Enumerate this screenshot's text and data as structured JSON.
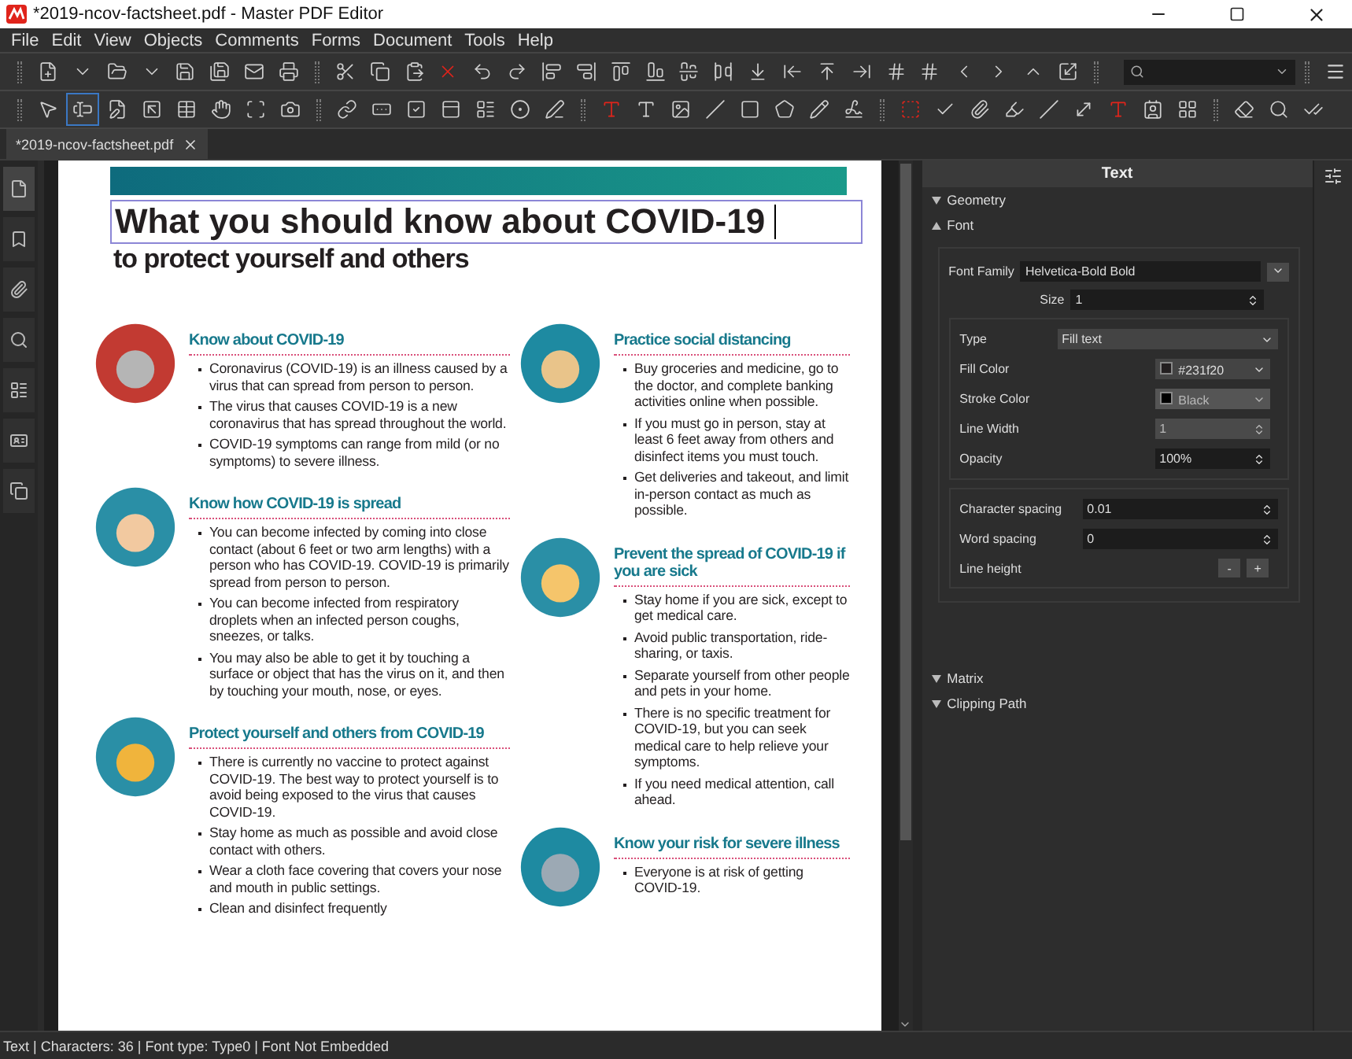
{
  "window": {
    "title": "*2019-ncov-factsheet.pdf - Master PDF Editor"
  },
  "menu": [
    "File",
    "Edit",
    "View",
    "Objects",
    "Comments",
    "Forms",
    "Document",
    "Tools",
    "Help"
  ],
  "edit_tools": [
    {
      "selected": false
    },
    {
      "selected": true
    },
    {
      "selected": false
    },
    {
      "selected": false
    },
    {
      "selected": false
    },
    {
      "selected": false
    },
    {
      "selected": false
    },
    {
      "selected": false
    }
  ],
  "tabs": [
    {
      "label": "*2019-ncov-factsheet.pdf",
      "selected": true
    }
  ],
  "side_tabs": [
    {
      "selected": true
    },
    {
      "selected": false
    },
    {
      "selected": false
    },
    {
      "selected": false
    },
    {
      "selected": false
    },
    {
      "selected": false
    },
    {
      "selected": false
    }
  ],
  "document": {
    "title": "What you should know about COVID-19",
    "subtitle": "to protect yourself and others",
    "columns": [
      [
        {
          "heading": "Know about COVID-19",
          "bullets": [
            "Coronavirus (COVID-19) is an illness caused by a virus that can spread from person to person.",
            "The virus that causes COVID-19 is a new coronavirus that has spread throughout the world.",
            "COVID-19 symptoms can range from mild (or no symptoms) to severe illness."
          ]
        },
        {
          "heading": "Know how COVID-19 is spread",
          "bullets": [
            "You can become infected by coming into close contact (about 6 feet or two arm lengths) with a person who has COVID-19. COVID-19 is primarily spread from person to person.",
            "You can become infected from respiratory droplets when an infected person coughs, sneezes, or talks.",
            "You may also be able to get it by touching a surface or object that has the virus on it, and then by touching your mouth, nose, or eyes."
          ]
        },
        {
          "heading": "Protect yourself and others from COVID-19",
          "bullets": [
            "There is currently no vaccine to protect against COVID-19. The best way to protect yourself is to avoid being exposed to the virus that causes COVID-19.",
            "Stay home as much as possible and avoid close contact with others.",
            "Wear a cloth face covering that covers your nose and mouth in public settings.",
            "Clean and disinfect frequently"
          ]
        }
      ],
      [
        {
          "heading": "Practice social distancing",
          "bullets": [
            "Buy groceries and medicine, go to the doctor, and complete banking activities online when possible.",
            "If you must go in person, stay at least 6 feet away from others and disinfect items you must touch.",
            "Get deliveries and takeout, and limit in-person contact as much as possible."
          ]
        },
        {
          "heading": "Prevent the spread of COVID-19 if you are sick",
          "bullets": [
            "Stay home if you are sick, except to get medical care.",
            "Avoid public transportation, ride-sharing, or taxis.",
            "Separate yourself from other people and pets in your home.",
            "There is no specific treatment for COVID-19, but you can seek medical care to help relieve your symptoms.",
            "If you need medical attention, call ahead."
          ]
        },
        {
          "heading": "Know your risk for severe illness",
          "bullets": [
            "Everyone is at risk of getting COVID-19."
          ]
        }
      ]
    ]
  },
  "panel": {
    "title": "Text",
    "sections": [
      {
        "label": "Geometry",
        "expanded": false
      },
      {
        "label": "Font",
        "expanded": true,
        "family": {
          "label": "Font Family",
          "value": "Helvetica-Bold Bold"
        },
        "size": {
          "label": "Size",
          "value": "1"
        },
        "style_fields": [
          {
            "kind": "select",
            "label": "Type",
            "value": "Fill text",
            "disabled": false
          },
          {
            "kind": "color",
            "label": "Fill Color",
            "value": "#231f20",
            "disabled": false
          },
          {
            "kind": "color",
            "label": "Stroke Color",
            "value": "Black",
            "disabled": true
          },
          {
            "kind": "spin",
            "label": "Line Width",
            "value": "1",
            "disabled": true
          },
          {
            "kind": "spin",
            "label": "Opacity",
            "value": "100%",
            "disabled": false
          }
        ],
        "spacing_fields": [
          {
            "kind": "spin",
            "label": "Character spacing",
            "value": "0.01"
          },
          {
            "kind": "spin",
            "label": "Word spacing",
            "value": "0"
          },
          {
            "kind": "buttons",
            "label": "Line height",
            "buttons": [
              "-",
              "+"
            ]
          }
        ]
      },
      {
        "label": "Matrix",
        "expanded": false
      },
      {
        "label": "Clipping Path",
        "expanded": false
      }
    ]
  },
  "status_bar": "Text | Characters: 36 | Font type: Type0 | Font Not Embedded"
}
